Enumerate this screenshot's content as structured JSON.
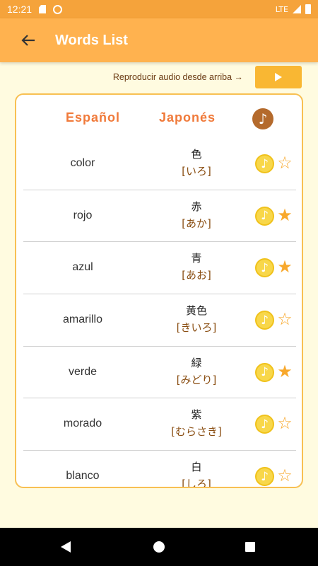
{
  "status": {
    "time": "12:21",
    "network": "LTE"
  },
  "appbar": {
    "title": "Words List"
  },
  "audio": {
    "label": "Reproducir audio desde arriba →",
    "play_icon": "▶"
  },
  "header": {
    "spanish": "Español",
    "japanese": "Japonés",
    "note": "♪"
  },
  "icons": {
    "note": "♪",
    "star_filled": "★",
    "star_empty": "☆"
  },
  "words": [
    {
      "es": "color",
      "kanji": "色",
      "kana": "[いろ]",
      "fav": false
    },
    {
      "es": "rojo",
      "kanji": "赤",
      "kana": "[あか]",
      "fav": true
    },
    {
      "es": "azul",
      "kanji": "青",
      "kana": "[あお]",
      "fav": true
    },
    {
      "es": "amarillo",
      "kanji": "黄色",
      "kana": "[きいろ]",
      "fav": false
    },
    {
      "es": "verde",
      "kanji": "緑",
      "kana": "[みどり]",
      "fav": true
    },
    {
      "es": "morado",
      "kanji": "紫",
      "kana": "[むらさき]",
      "fav": false
    },
    {
      "es": "blanco",
      "kanji": "白",
      "kana": "[しろ]",
      "fav": false
    }
  ],
  "colors": {
    "appbar": "#ffb24f",
    "statusbar": "#f5a33b",
    "accent": "#f8a82c",
    "background": "#fffbe0"
  }
}
